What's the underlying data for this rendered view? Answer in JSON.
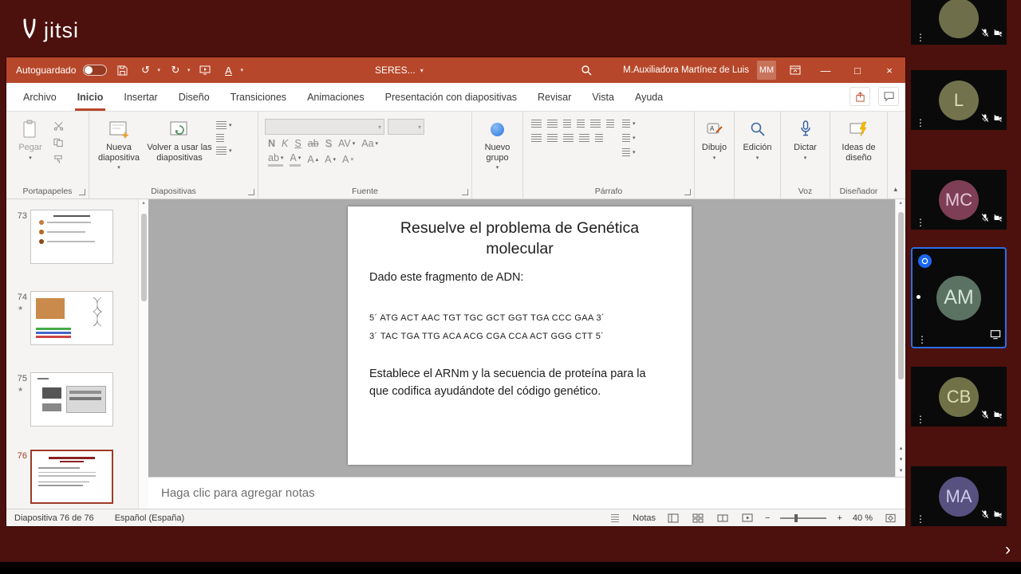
{
  "colors": {
    "background": "#4c100d",
    "titlebar": "#b7472a",
    "accent": "#b7472a",
    "ribbon_bg": "#f5f4f2",
    "tabs_bg": "#ffffff",
    "canvas_bg": "#ababab",
    "tile_bg": "#0a0a0a",
    "active_tile_border": "#2b6fe4"
  },
  "jitsi": {
    "logo_text": "jitsi"
  },
  "titlebar": {
    "autosave_label": "Autoguardado",
    "doc_title": "SERES...",
    "user_name": "M.Auxiliadora Martínez de Luis",
    "user_initials": "MM"
  },
  "tabs": [
    {
      "label": "Archivo"
    },
    {
      "label": "Inicio"
    },
    {
      "label": "Insertar"
    },
    {
      "label": "Diseño"
    },
    {
      "label": "Transiciones"
    },
    {
      "label": "Animaciones"
    },
    {
      "label": "Presentación con diapositivas"
    },
    {
      "label": "Revisar"
    },
    {
      "label": "Vista"
    },
    {
      "label": "Ayuda"
    }
  ],
  "ribbon": {
    "paste_label": "Pegar",
    "new_slide_label": "Nueva diapositiva",
    "reuse_slides_label": "Volver a usar las diapositivas",
    "new_group_label": "Nuevo grupo",
    "draw_label": "Dibujo",
    "edit_label": "Edición",
    "dictate_label": "Dictar",
    "design_ideas_label": "Ideas de diseño",
    "font_buttons": {
      "bold": "N",
      "italic": "K",
      "underline": "S",
      "strikethrough": "ab",
      "shadow": "S",
      "spacing": "AV",
      "case": "Aa",
      "highlight": "ab",
      "color": "A",
      "grow": "A",
      "shrink": "A",
      "clear": "A"
    },
    "group_labels": {
      "clipboard": "Portapapeles",
      "slides": "Diapositivas",
      "font": "Fuente",
      "paragraph": "Párrafo",
      "voice": "Voz",
      "designer": "Diseñador"
    }
  },
  "thumbnails": [
    {
      "number": "73",
      "starred": false
    },
    {
      "number": "74",
      "starred": true
    },
    {
      "number": "75",
      "starred": true
    },
    {
      "number": "76",
      "starred": false
    }
  ],
  "slide": {
    "title": "Resuelve el problema de Genética molecular",
    "intro": "Dado este fragmento de ADN:",
    "sequence1": "5´ ATG ACT AAC TGT TGC GCT GGT TGA CCC GAA 3´",
    "sequence2": "3´ TAC TGA TTG ACA ACG CGA CCA ACT GGG CTT 5´",
    "body": "Establece el ARNm y la secuencia de proteína para la que codifica ayudándote del código genético."
  },
  "notes": {
    "placeholder": "Haga clic para agregar notas"
  },
  "statusbar": {
    "slide_counter": "Diapositiva 76 de 76",
    "language": "Español (España)",
    "notes_label": "Notas",
    "zoom_level": "40 %"
  },
  "participants": [
    {
      "initials": "",
      "color": "#6e6f4a",
      "text_color": "#d8d9b4"
    },
    {
      "initials": "L",
      "color": "#72734c",
      "text_color": "#dcddb6"
    },
    {
      "initials": "MC",
      "color": "#7d3e56",
      "text_color": "#e6c6d4"
    },
    {
      "initials": "AM",
      "color": "#5b7263",
      "text_color": "#d5e3d5"
    },
    {
      "initials": "CB",
      "color": "#707146",
      "text_color": "#dcddb0"
    },
    {
      "initials": "MA",
      "color": "#575180",
      "text_color": "#cfc9ea"
    }
  ],
  "icons": {
    "overflow_menu": "⋮",
    "chevron_right": "›",
    "star": "★",
    "scroll_up": "▴",
    "scroll_down": "▾",
    "collapse_ribbon": "▴",
    "undo": "↺",
    "redo": "↻",
    "minimize": "—",
    "maximize": "□",
    "close": "×",
    "zoom_out": "−",
    "zoom_in": "+"
  }
}
